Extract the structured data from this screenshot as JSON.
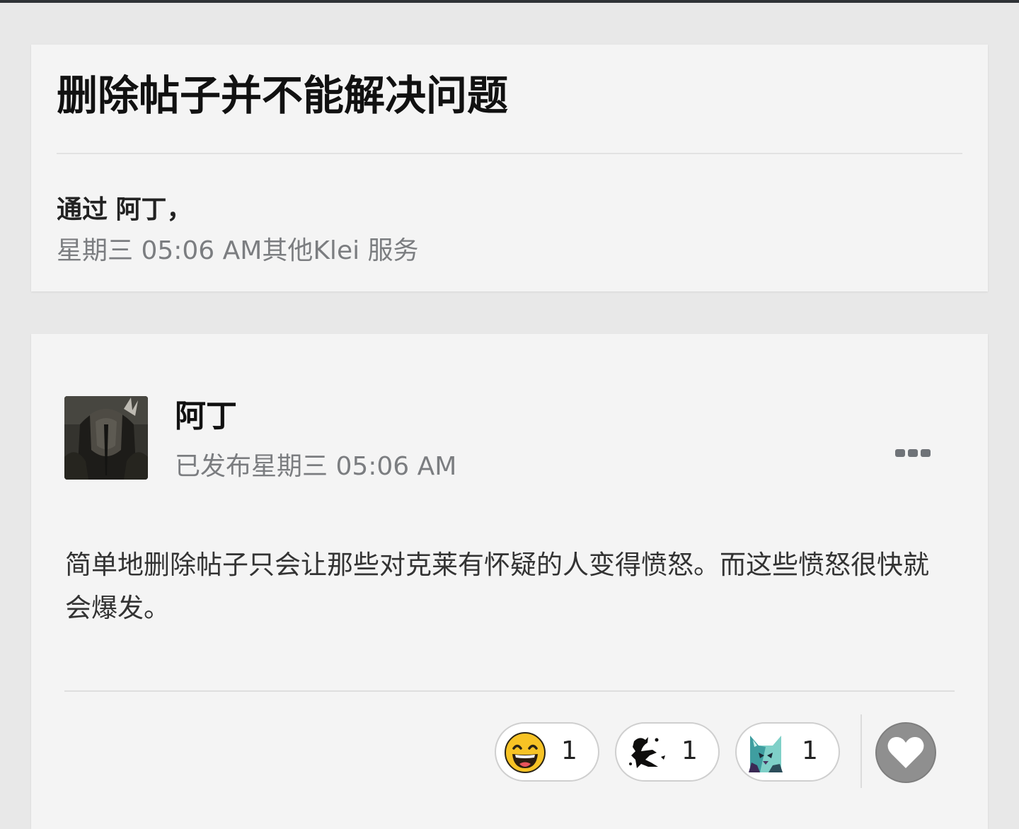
{
  "topic": {
    "title": "删除帖子并不能解决问题",
    "byline_prefix": "通过",
    "author": "阿丁",
    "byline_suffix": "，",
    "date": "星期三 05:06 AM",
    "category": "其他Klei 服务"
  },
  "post": {
    "author": "阿丁",
    "posted": "已发布星期三 05:06 AM",
    "body": "简单地删除帖子只会让那些对克莱有怀疑的人变得愤怒。而这些愤怒很快就会爆发。",
    "menu_icon": "ellipsis-icon"
  },
  "reactions": [
    {
      "icon": "laughing-face-icon",
      "count": "1"
    },
    {
      "icon": "ink-splatter-icon",
      "count": "1"
    },
    {
      "icon": "cat-portrait-icon",
      "count": "1"
    }
  ],
  "like_icon": "heart-icon",
  "colors": {
    "page_bg": "#e8e8e8",
    "card_bg": "#f4f4f4",
    "muted_text": "#7b7d80",
    "like_button": "#8f8f8f",
    "top_strip": "#2f3236"
  }
}
